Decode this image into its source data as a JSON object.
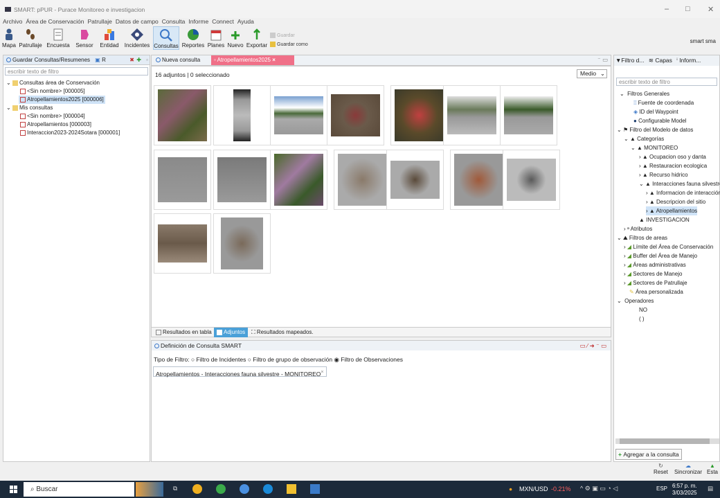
{
  "window": {
    "title": "SMART: pPUR - Purace Monitoreo e investigacion",
    "minimize": "–",
    "maximize": "□",
    "close": "✕"
  },
  "menu": [
    "Archivo",
    "Área de Conservación",
    "Patrullaje",
    "Datos de campo",
    "Consulta",
    "Informe",
    "Connect",
    "Ayuda"
  ],
  "toolbar": {
    "items": [
      "Mapa",
      "Patrullaje",
      "Encuesta",
      "Sensor",
      "Entidad",
      "Incidentes",
      "Consultas",
      "Reportes",
      "Planes"
    ],
    "nuevo": "Nuevo",
    "exportar": "Exportar",
    "guardar": "Guardar",
    "guardar_como": "Guardar como",
    "user": "smart sma"
  },
  "left": {
    "tab": "Guardar Consultas/Resumenes",
    "tab2": "R",
    "filter_placeholder": "escribir texto de filtro",
    "tree": [
      "Consultas área de Conservación",
      "<Sin nombre> [000005]",
      "Atropellamientos2025 [000006]",
      "Mis consultas",
      "<Sin nombre> [000004]",
      "Atropellamientos [000003]",
      "Interaccion2023-2024Sotara [000001]"
    ]
  },
  "center": {
    "tabs": [
      "Nueva consulta",
      "Atropellamientos2025"
    ],
    "adjuntos_count": "16 adjuntos",
    "selected": "0 seleccionado",
    "size": "Medio",
    "bottom_tabs": [
      "Resultados en tabla",
      "Adjuntos",
      "Resultados mapeados."
    ],
    "def_title": "Definición de Consulta SMART",
    "filter_type_label": "Tipo de Filtro:",
    "radio": [
      "Filtro de Incidentes",
      "Filtro de grupo de observación",
      "Filtro de Observaciones"
    ],
    "chip": "Atropellamientos - Interacciones fauna silvestre - MONITOREO"
  },
  "right": {
    "tabs": [
      "Filtro d...",
      "Capas",
      "Inform..."
    ],
    "filter_placeholder": "escribir texto de filtro",
    "tree": [
      "Filtros Generales",
      "Fuente de coordenada",
      "ID del Waypoint",
      "Configurable Model",
      "Filtro del Modelo de datos",
      "Categorías",
      "MONITOREO",
      "Ocupacion oso y danta",
      "Restauracion ecologica",
      "Recurso hidrico",
      "Interacciones fauna silvestre",
      "Informacion de interacción",
      "Descripcion del sitio",
      "Atropellamientos",
      "INVESTIGACION",
      "Atributos",
      "Filtros de areas",
      "Límite del Área de Conservación",
      "Buffer del Área de Manejo",
      "Áreas administrativas",
      "Sectores de Manejo",
      "Sectores de Patrullaje",
      "Área personalizada",
      "Operadores",
      "NO",
      "( )"
    ],
    "add_button": "Agregar a la consulta"
  },
  "status": {
    "reset": "Reset",
    "sync": "Sincronizar",
    "esta": "Esta"
  },
  "taskbar": {
    "search": "Buscar",
    "ticker": "MXN/USD",
    "ticker_val": "-0.21%",
    "lang": "ESP",
    "time": "6:57 p. m.",
    "date": "3/03/2025"
  },
  "colors": {
    "accent": "#3c78c8",
    "selected_tab": "#f07088",
    "tree_sel": "#cfe3f7"
  }
}
